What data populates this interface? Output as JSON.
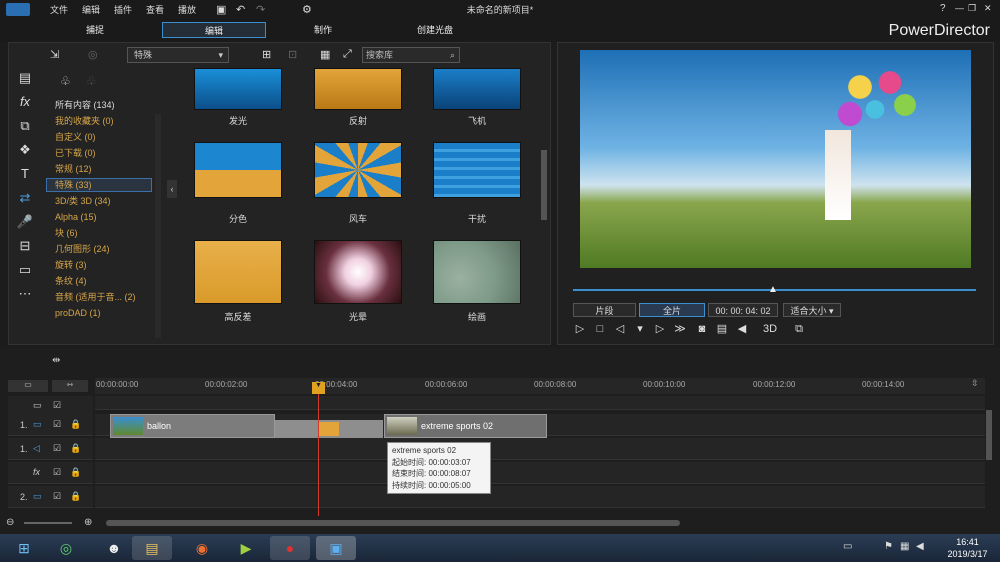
{
  "app": {
    "title": "未命名的新项目*",
    "brand": "PowerDirector"
  },
  "menu": [
    "文件",
    "编辑",
    "插件",
    "查看",
    "播放"
  ],
  "tabs": [
    "捕捉",
    "编辑",
    "制作",
    "创建光盘"
  ],
  "library": {
    "dropdown": "特殊",
    "search_placeholder": "搜索库",
    "categories": [
      {
        "label": "所有内容 (134)",
        "color": "white"
      },
      {
        "label": "我的收藏夹 (0)"
      },
      {
        "label": "自定义 (0)"
      },
      {
        "label": "已下载 (0)"
      },
      {
        "label": "常规 (12)"
      },
      {
        "label": "特殊 (33)"
      },
      {
        "label": "3D/类 3D (34)"
      },
      {
        "label": "Alpha (15)"
      },
      {
        "label": "块 (6)"
      },
      {
        "label": "几何图形 (24)"
      },
      {
        "label": "旋转 (3)"
      },
      {
        "label": "条纹 (4)"
      },
      {
        "label": "音频 (适用于音... (2)"
      },
      {
        "label": "proDAD (1)"
      }
    ],
    "thumbs": [
      [
        "发光",
        "反射",
        "飞机"
      ],
      [
        "分色",
        "风车",
        "干扰"
      ],
      [
        "高反差",
        "光晕",
        "绘画"
      ]
    ]
  },
  "preview": {
    "clip_btn": "片段",
    "full_btn": "全片",
    "timecode": "00: 00: 04: 02",
    "fit": "适合大小",
    "mode3d": "3D"
  },
  "ruler": [
    "00:00:00:00",
    "00:00:02:00",
    "00:00:04:00",
    "00:00:06:00",
    "00:00:08:00",
    "00:00:10:00",
    "00:00:12:00",
    "00:00:14:00"
  ],
  "tracks": [
    {
      "num": "1."
    },
    {
      "num": "1."
    },
    {
      "num": ""
    },
    {
      "num": "2."
    }
  ],
  "clips": {
    "clip1": "ballon",
    "clip2": "extreme sports 02"
  },
  "tooltip": {
    "title": "extreme sports 02",
    "start": "起始时间: 00:00:03:07",
    "end": "结束时间: 00:00:08:07",
    "dur": "持续时间: 00:00:05:00"
  },
  "clock": {
    "time": "16:41",
    "date": "2019/3/17"
  },
  "playhead_value": "00:00:04:02"
}
